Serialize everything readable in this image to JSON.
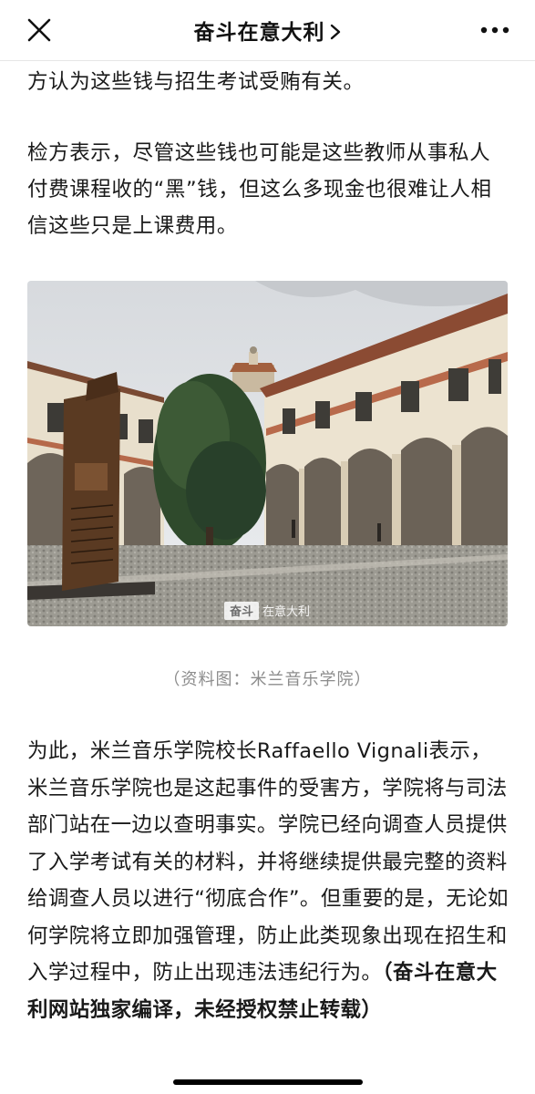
{
  "nav": {
    "title": "奋斗在意大利"
  },
  "article": {
    "paragraphs": [
      "方认为这些钱与招生考试受贿有关。",
      "检方表示，尽管这些钱也可能是这些教师从事私人付费课程收的“黑”钱，但这么多现金也很难让人相信这些只是上课费用。"
    ],
    "image_caption": "（资料图：米兰音乐学院）",
    "image_watermark": "奋斗在意大利",
    "paragraph3_text": "为此，米兰音乐学院校长Raffaello Vignali表示，米兰音乐学院也是这起事件的受害方，学院将与司法部门站在一边以查明事实。学院已经向调查人员提供了入学考试有关的材料，并将继续提供最完整的资料给调查人员以进行“彻底合作”。但重要的是，无论如何学院将立即加强管理，防止此类现象出现在招生和入学过程中，防止出现违法违纪行为。",
    "paragraph3_bold": "（奋斗在意大利网站独家编译，未经授权禁止转载）"
  },
  "icons": {
    "close": "close-icon",
    "chevron": "chevron-right-icon",
    "more": "more-icon"
  }
}
